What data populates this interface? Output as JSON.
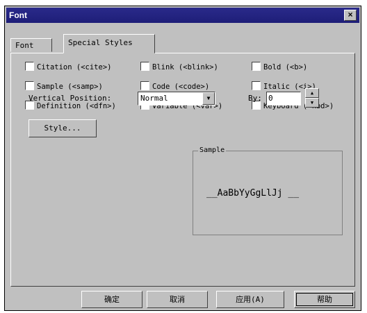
{
  "title": "Font",
  "close_glyph": "×",
  "tabs": [
    "Font",
    "Special Styles"
  ],
  "checkboxes": [
    "Citation (<cite>)",
    "Blink (<blink>)",
    "Bold (<b>)",
    "Sample (<samp>)",
    "Code (<code>)",
    "Italic (<i>)",
    "Definition (<dfn>)",
    "Variable (<var>)",
    "Keyboard (<kbd>)"
  ],
  "vertical_position": {
    "label": "Vertical Position:",
    "value": "Normal"
  },
  "by": {
    "label": "By:",
    "value": "0"
  },
  "style_button": "Style...",
  "sample": {
    "legend": "Sample",
    "text": "__AaBbYyGgLlJj __"
  },
  "buttons": {
    "ok": "确定",
    "cancel": "取消",
    "apply": "应用(A)",
    "help": "帮助"
  }
}
